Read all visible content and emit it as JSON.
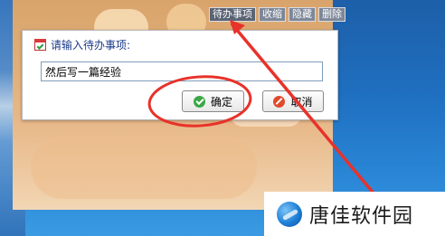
{
  "toolbar": {
    "items": [
      {
        "label": "待办事项"
      },
      {
        "label": "收缩"
      },
      {
        "label": "隐藏"
      },
      {
        "label": "删除"
      }
    ]
  },
  "dialog": {
    "title": "请输入待办事项:",
    "input_value": "然后写一篇经验",
    "ok_label": "确定",
    "cancel_label": "取消"
  },
  "watermark": {
    "text": "唐佳软件园"
  },
  "icons": {
    "title": "calendar-check-icon",
    "ok": "check-circle-icon",
    "cancel": "forbidden-circle-icon",
    "watermark": "globe-logo-icon"
  },
  "colors": {
    "annotation": "#e8322a",
    "title_text": "#1a3a8a",
    "ok_icon": "#3aa845",
    "cancel_icon": "#e04a2a"
  }
}
